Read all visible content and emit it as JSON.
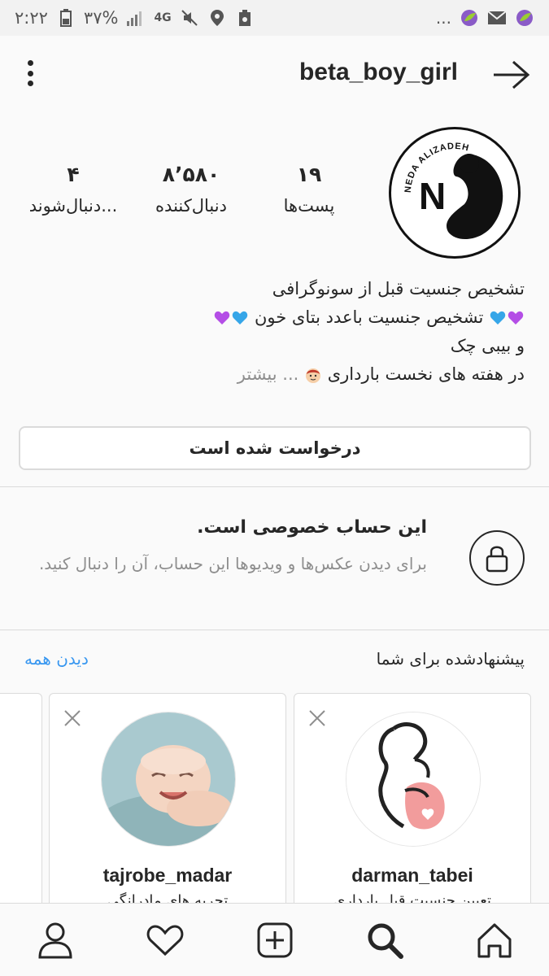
{
  "status_bar": {
    "time": "۲:۲۲",
    "battery": "۳۷%",
    "network": "4G",
    "more": "..."
  },
  "header": {
    "username": "beta_boy_girl"
  },
  "avatar": {
    "logo_text": "NEDA ALIZADEH",
    "logo_letter": "N"
  },
  "stats": [
    {
      "value": "۱۹",
      "label": "پست‌ها"
    },
    {
      "value": "۸٬۵۸۰",
      "label": "دنبال‌کننده"
    },
    {
      "value": "۴",
      "label": "دنبال‌شوند..."
    }
  ],
  "bio": {
    "line1": "تشخیص جنسیت قبل از سونوگرافی",
    "line2": "تشخیص جنسیت باعدد بتای خون",
    "line3": "و بیبی چک",
    "line4": "در هفته های نخست بارداری",
    "more": "... بیشتر"
  },
  "requested_button": "درخواست شده است",
  "private": {
    "title": "این حساب خصوصی است.",
    "description": "برای دیدن عکس‌ها و ویدیوها این حساب، آن را دنبال کنید."
  },
  "suggested": {
    "title": "پیشنهادشده برای شما",
    "see_all": "دیدن همه",
    "cards": [
      {
        "username": "darman_tabei",
        "subtitle": "تعیین جنسیت قبل بارداری"
      },
      {
        "username": "tajrobe_madar",
        "subtitle": "تجربه های مادرانگی"
      }
    ]
  },
  "colors": {
    "link_blue": "#3897f0",
    "secondary_text": "#8e8e8e",
    "border": "#dbdbdb"
  }
}
